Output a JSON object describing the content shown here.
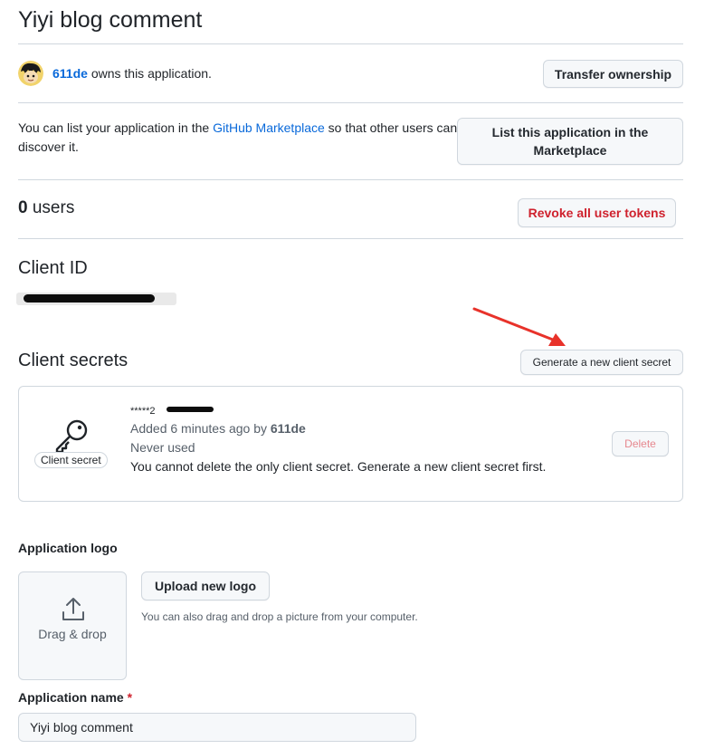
{
  "page": {
    "title": "Yiyi blog comment"
  },
  "owner": {
    "username": "611de",
    "owns_text": "owns this application.",
    "transfer_button": "Transfer ownership"
  },
  "marketplace": {
    "text_before": "You can list your application in the ",
    "link": "GitHub Marketplace",
    "text_after": " so that other users can discover it.",
    "button": "List this application in the Marketplace"
  },
  "users": {
    "count": "0",
    "label": "users",
    "revoke_button": "Revoke all user tokens"
  },
  "client_id": {
    "heading": "Client ID"
  },
  "client_secrets": {
    "heading": "Client secrets",
    "generate_button": "Generate a new client secret",
    "secret": {
      "badge": "Client secret",
      "masked_value": "*****2",
      "added_text": "Added 6 minutes ago by ",
      "added_by": "611de",
      "usage": "Never used",
      "warning": "You cannot delete the only client secret. Generate a new client secret first.",
      "delete_button": "Delete"
    }
  },
  "logo": {
    "heading": "Application logo",
    "dropzone_text": "Drag & drop",
    "upload_button": "Upload new logo",
    "note": "You can also drag and drop a picture from your computer."
  },
  "app_name": {
    "label": "Application name",
    "required_mark": "*",
    "value": "Yiyi blog comment"
  },
  "colors": {
    "link": "#0969da",
    "danger": "#cf222e",
    "border": "#d0d7de",
    "annotation_arrow": "#e8322a"
  },
  "icons": {
    "avatar": "anime-avatar",
    "key": "key-icon",
    "upload": "upload-icon",
    "arrow": "red-annotation-arrow"
  }
}
